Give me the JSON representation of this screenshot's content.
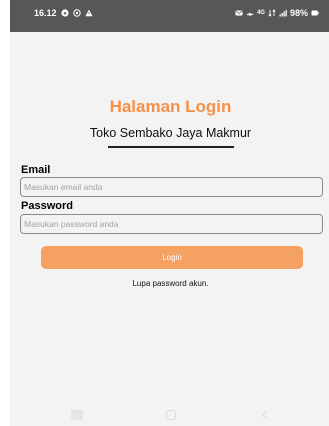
{
  "status_bar": {
    "time": "16.12",
    "network": "4G",
    "battery": "98%"
  },
  "login": {
    "title": "Halaman Login",
    "subtitle": "Toko Sembako Jaya Makmur",
    "email_label": "Email",
    "email_placeholder": "Masukan email anda",
    "password_label": "Password",
    "password_placeholder": "Masukan password anda",
    "login_button": "Login",
    "forgot_password": "Lupa password akun."
  },
  "colors": {
    "accent": "#f5914a",
    "button": "#f5a161",
    "status_bar": "#575757",
    "background": "#f3f3f3"
  },
  "icons": {
    "status_left": [
      "notification-icon",
      "cast-icon",
      "warning-icon"
    ],
    "status_right": [
      "message-icon",
      "hotspot-icon",
      "data-icon",
      "signal-icon",
      "battery-icon"
    ],
    "nav": [
      "recent-apps-icon",
      "home-icon",
      "back-icon"
    ]
  }
}
